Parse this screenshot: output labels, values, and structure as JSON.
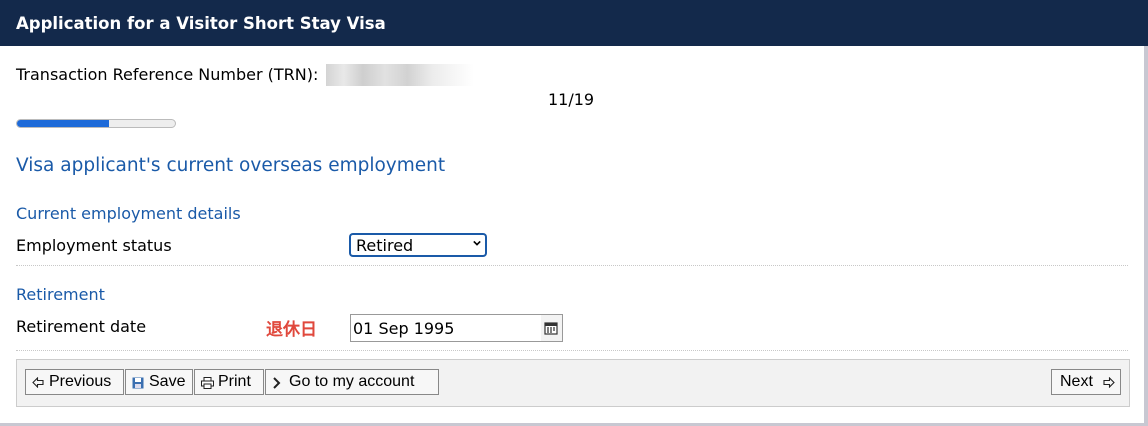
{
  "header": {
    "title": "Application for a Visitor Short Stay Visa",
    "bg_color": "#13294b"
  },
  "trn": {
    "label": "Transaction Reference Number (TRN):"
  },
  "pager": {
    "text": "11/19",
    "progress_fraction": 0.58
  },
  "main": {
    "heading": "Visa applicant's current overseas employment",
    "employment_section": {
      "title": "Current employment details",
      "status_label": "Employment status",
      "status_value": "Retired"
    },
    "retirement_section": {
      "title": "Retirement",
      "date_label": "Retirement date",
      "annotation": "退休日",
      "date_value": "01 Sep 1995"
    }
  },
  "toolbar": {
    "previous_label": "Previous",
    "save_label": "Save",
    "print_label": "Print",
    "account_label": "Go to my account",
    "next_label": "Next"
  },
  "colors": {
    "accent": "#1a5aa8",
    "progress": "#1d6ad9",
    "annotation": "#e0483c"
  }
}
